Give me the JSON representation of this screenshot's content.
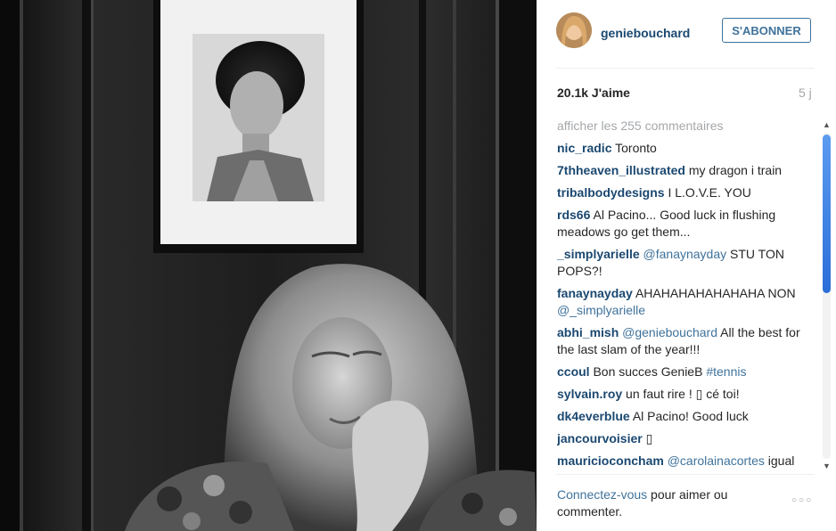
{
  "post": {
    "username": "geniebouchard",
    "follow_label": "S'ABONNER",
    "likes": "20.1k J'aime",
    "age": "5 j",
    "view_all": "afficher les 255 commentaires"
  },
  "comments": [
    {
      "user": "nic_radic",
      "parts": [
        {
          "t": "text",
          "v": "Toronto"
        }
      ]
    },
    {
      "user": "7thheaven_illustrated",
      "parts": [
        {
          "t": "text",
          "v": "my dragon i train"
        }
      ]
    },
    {
      "user": "tribalbodydesigns",
      "parts": [
        {
          "t": "text",
          "v": "I L.O.V.E. YOU"
        }
      ]
    },
    {
      "user": "rds66",
      "parts": [
        {
          "t": "text",
          "v": "Al Pacino... Good luck in flushing meadows go get them..."
        }
      ]
    },
    {
      "user": "_simplyarielle",
      "parts": [
        {
          "t": "mention",
          "v": "@fanaynayday"
        },
        {
          "t": "text",
          "v": " STU TON POPS?!"
        }
      ]
    },
    {
      "user": "fanaynayday",
      "parts": [
        {
          "t": "text",
          "v": "AHAHAHAHAHAHAHA NON "
        },
        {
          "t": "mention",
          "v": "@_simplyarielle"
        }
      ]
    },
    {
      "user": "abhi_mish",
      "parts": [
        {
          "t": "mention",
          "v": "@geniebouchard"
        },
        {
          "t": "text",
          "v": " All the best for the last slam of the year!!!"
        }
      ]
    },
    {
      "user": "ccoul",
      "parts": [
        {
          "t": "text",
          "v": "Bon succes GenieB "
        },
        {
          "t": "hashtag",
          "v": "#tennis"
        }
      ]
    },
    {
      "user": "sylvain.roy",
      "parts": [
        {
          "t": "text",
          "v": "un faut rire ! ▯ cé toi!"
        }
      ]
    },
    {
      "user": "dk4everblue",
      "parts": [
        {
          "t": "text",
          "v": "Al Pacino! Good luck"
        }
      ]
    },
    {
      "user": "jancourvoisier",
      "parts": [
        {
          "t": "text",
          "v": "▯"
        }
      ]
    },
    {
      "user": "mauricioconcham",
      "parts": [
        {
          "t": "mention",
          "v": "@carolainacortes"
        },
        {
          "t": "text",
          "v": " igual que vo!! Con un cuadro de el!! Tenemos"
        }
      ]
    }
  ],
  "footer": {
    "login_link": "Connectez-vous",
    "login_rest": " pour aimer ou commenter.",
    "options_icon": "more-options-icon"
  },
  "colors": {
    "link": "#3f729b",
    "username": "#1b4870",
    "muted": "#a5a7aa"
  }
}
